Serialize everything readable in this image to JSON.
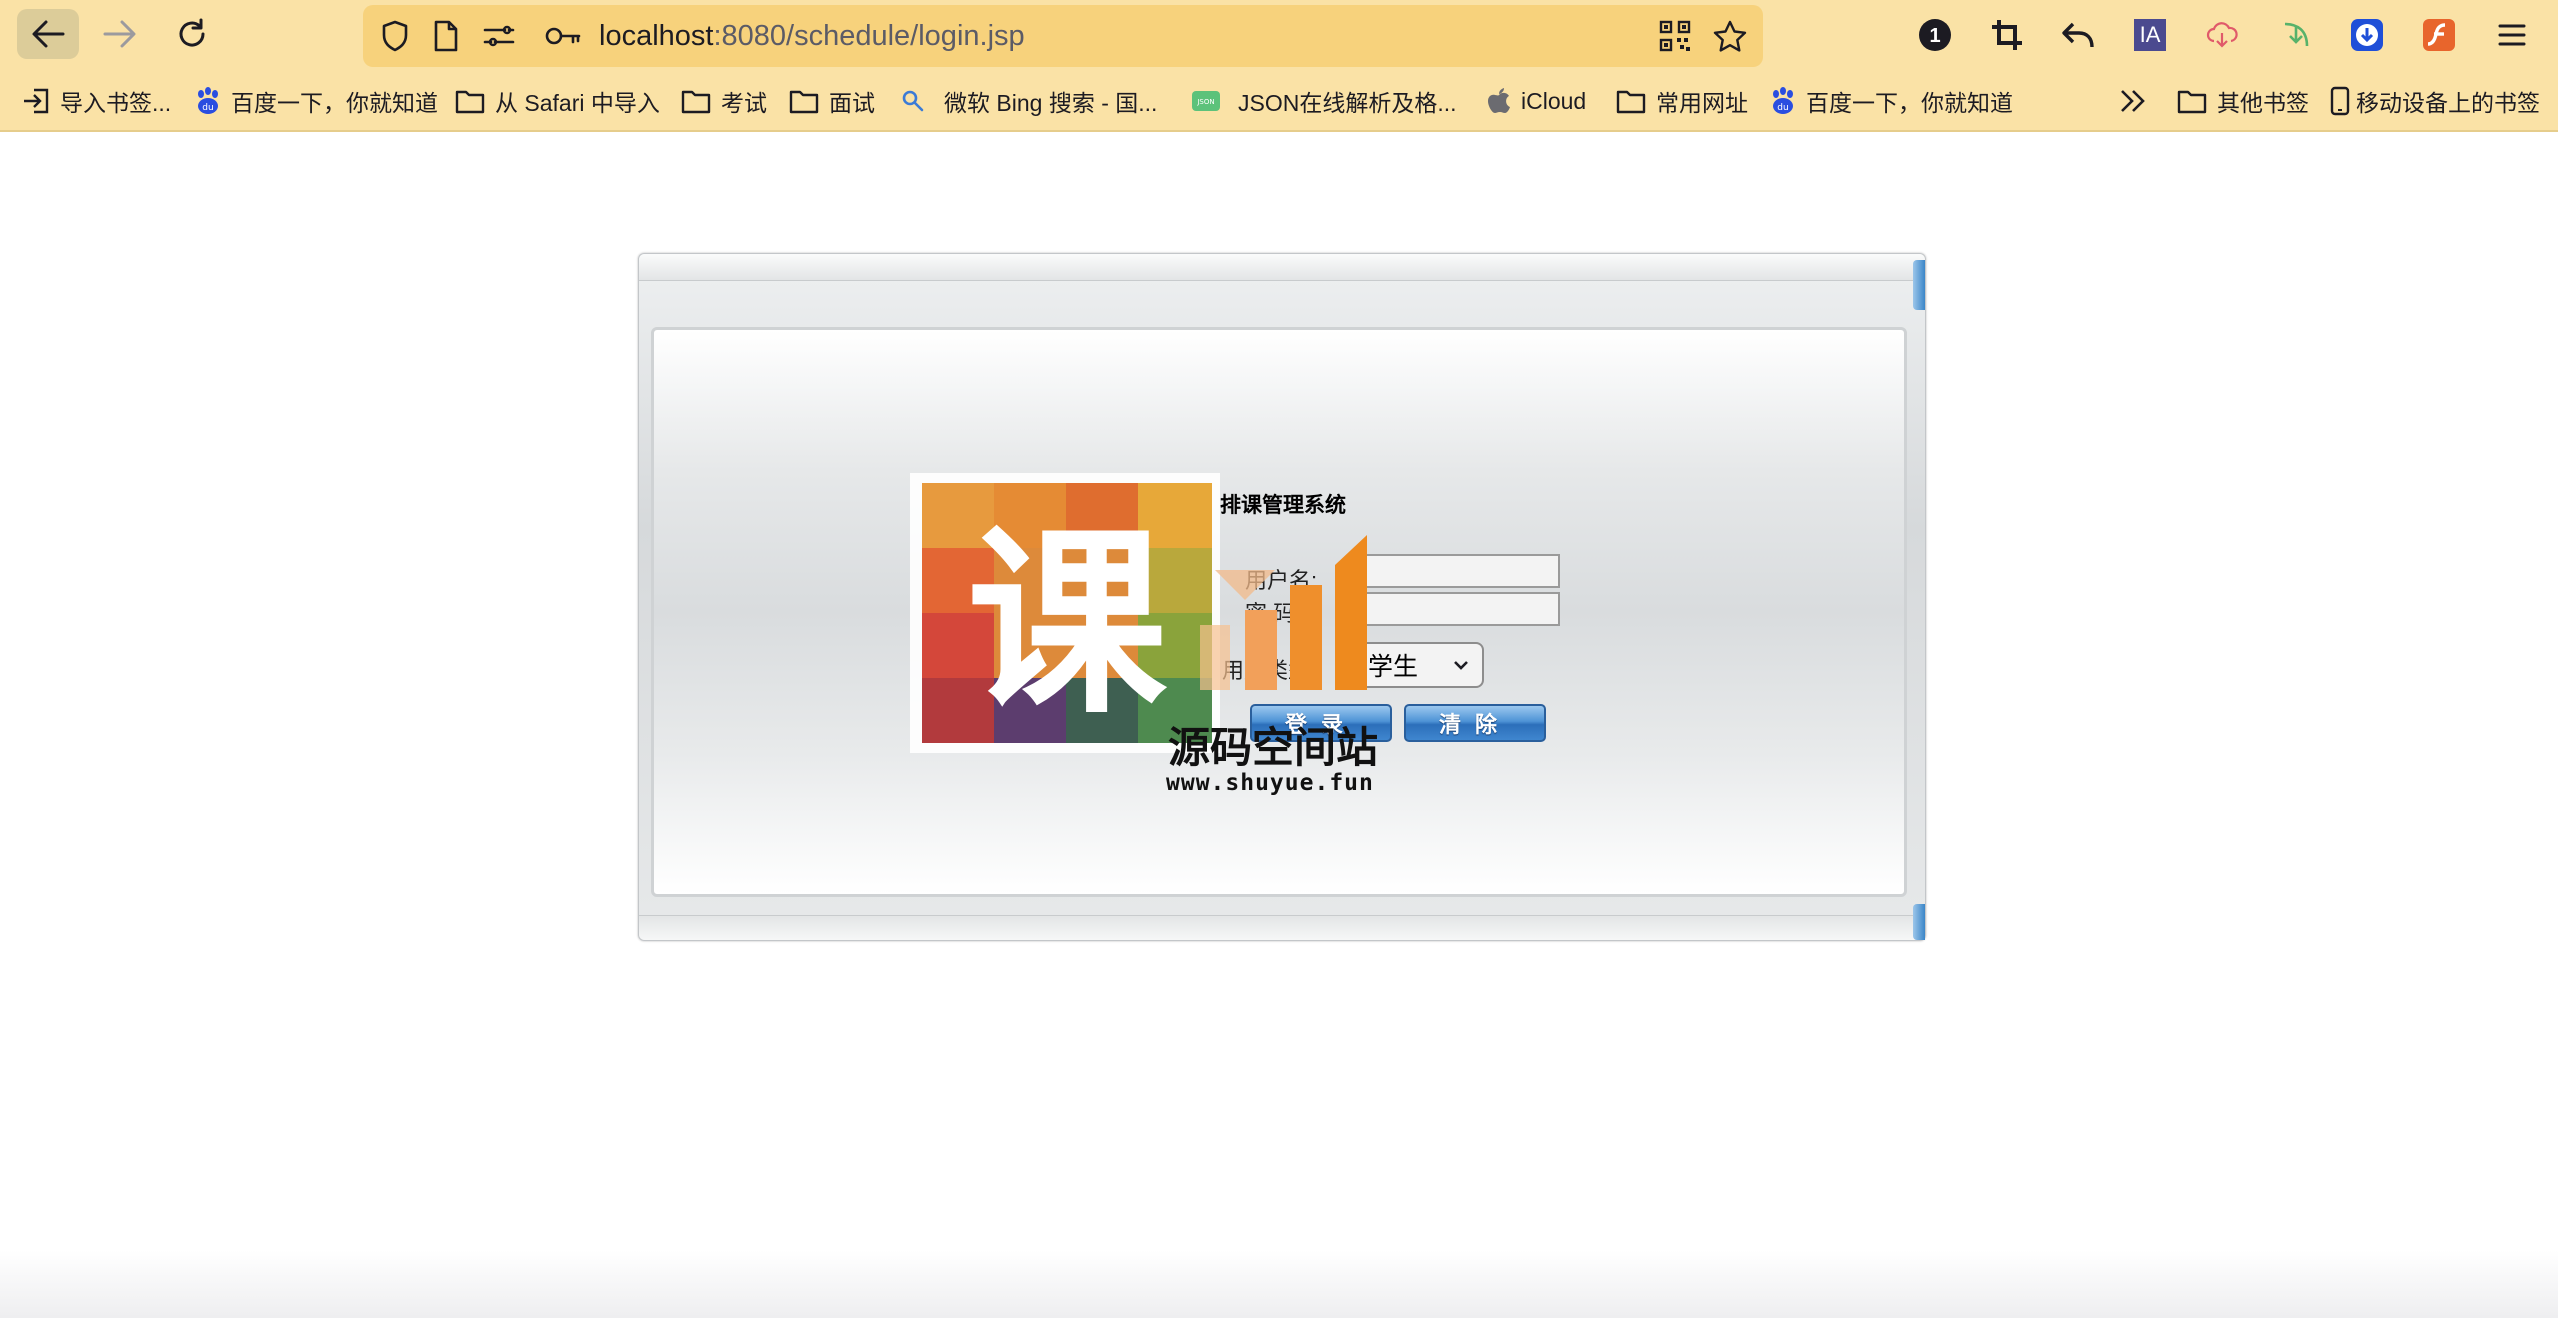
{
  "browser": {
    "url_host": "localhost",
    "url_path": ":8080/schedule/login.jsp",
    "badge_count": "1",
    "ia_label": "IA"
  },
  "bookmarks": [
    {
      "label": "导入书签...",
      "icon": "import-icon"
    },
    {
      "label": "百度一下，你就知道",
      "icon": "baidu-icon"
    },
    {
      "label": "从 Safari 中导入",
      "icon": "folder-icon"
    },
    {
      "label": "考试",
      "icon": "folder-icon"
    },
    {
      "label": "面试",
      "icon": "folder-icon"
    },
    {
      "label": "微软 Bing 搜索 - 国...",
      "icon": "search-icon"
    },
    {
      "label": "JSON在线解析及格...",
      "icon": "json-icon"
    },
    {
      "label": "iCloud",
      "icon": "apple-icon"
    },
    {
      "label": "常用网址",
      "icon": "folder-icon"
    },
    {
      "label": "百度一下，你就知道",
      "icon": "baidu-icon"
    }
  ],
  "bookmarks_right": [
    {
      "label": "其他书签",
      "icon": "folder-icon"
    },
    {
      "label": "移动设备上的书签",
      "icon": "mobile-icon"
    }
  ],
  "login": {
    "title": "排课管理系统",
    "username_label": "用户名:",
    "password_label": "密 码:",
    "usertype_label": "用户类型:",
    "usertype_value": "学生",
    "login_button": "登录",
    "clear_button": "清除"
  },
  "watermark": {
    "logo_char": "课",
    "site_name": "源码空间站",
    "site_url": "www.shuyue.fun"
  }
}
